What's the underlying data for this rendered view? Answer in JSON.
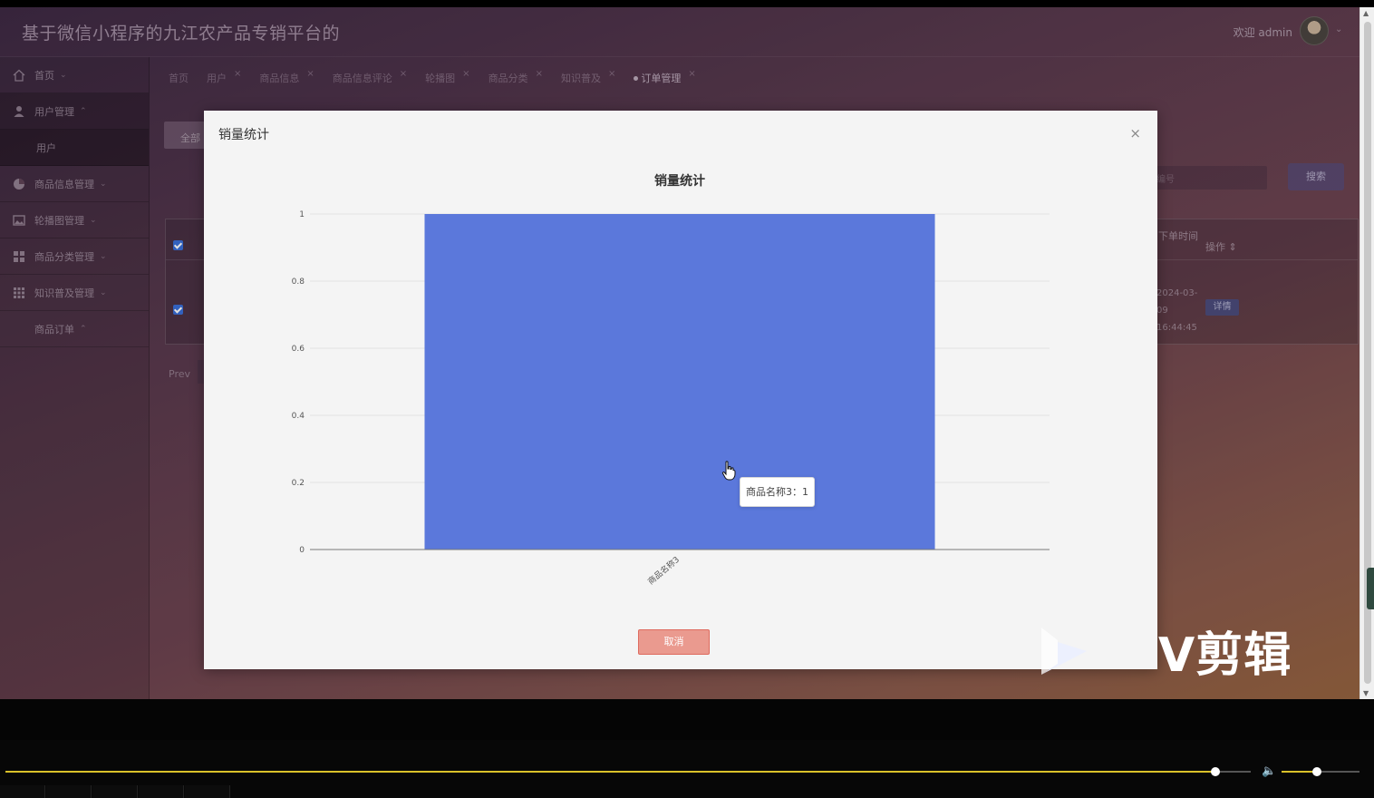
{
  "app": {
    "title": "基于微信小程序的九江农产品专销平台的",
    "welcome": "欢迎 admin"
  },
  "sidebar": {
    "items": [
      {
        "label": "首页",
        "icon": "home-icon",
        "caret": "⌄"
      },
      {
        "label": "用户管理",
        "icon": "user-icon",
        "caret": "⌃",
        "sub": [
          "用户"
        ]
      },
      {
        "label": "商品信息管理",
        "icon": "pie-icon",
        "caret": "⌄"
      },
      {
        "label": "轮播图管理",
        "icon": "image-icon",
        "caret": "⌄"
      },
      {
        "label": "商品分类管理",
        "icon": "grid-icon",
        "caret": "⌄"
      },
      {
        "label": "知识普及管理",
        "icon": "apps-icon",
        "caret": "⌄"
      },
      {
        "label": "商品订单",
        "icon": "",
        "caret": "⌃"
      }
    ]
  },
  "tabs": [
    {
      "label": "首页",
      "closable": false
    },
    {
      "label": "用户",
      "closable": true
    },
    {
      "label": "商品信息",
      "closable": true
    },
    {
      "label": "商品信息评论",
      "closable": true
    },
    {
      "label": "轮播图",
      "closable": true
    },
    {
      "label": "商品分类",
      "closable": true
    },
    {
      "label": "知识普及",
      "closable": true
    },
    {
      "label": "订单管理",
      "closable": true,
      "active": true
    }
  ],
  "background_page": {
    "all_button": "全部",
    "search_placeholder": "编号",
    "search_button": "搜索",
    "table": {
      "col_time": "下单时间",
      "col_op": "操作 ⇕",
      "row_time": "2024-03-09 16:44:45",
      "detail_button": "详情"
    },
    "prev": "Prev"
  },
  "modal": {
    "title": "销量统计",
    "close": "×",
    "cancel": "取消",
    "tooltip": "商品名称3：1"
  },
  "chart_data": {
    "type": "bar",
    "title": "销量统计",
    "categories": [
      "商品名称3"
    ],
    "values": [
      1
    ],
    "ylim": [
      0,
      1
    ],
    "yticks": [
      "0",
      "0.2",
      "0.4",
      "0.6",
      "0.8",
      "1"
    ],
    "grid": true,
    "bar_color": "#5b78db"
  },
  "watermark": {
    "text": "V剪辑"
  },
  "colors": {
    "accent": "#5b78db",
    "cancel": "#ea9a8f",
    "progress": "#d9c12a"
  }
}
